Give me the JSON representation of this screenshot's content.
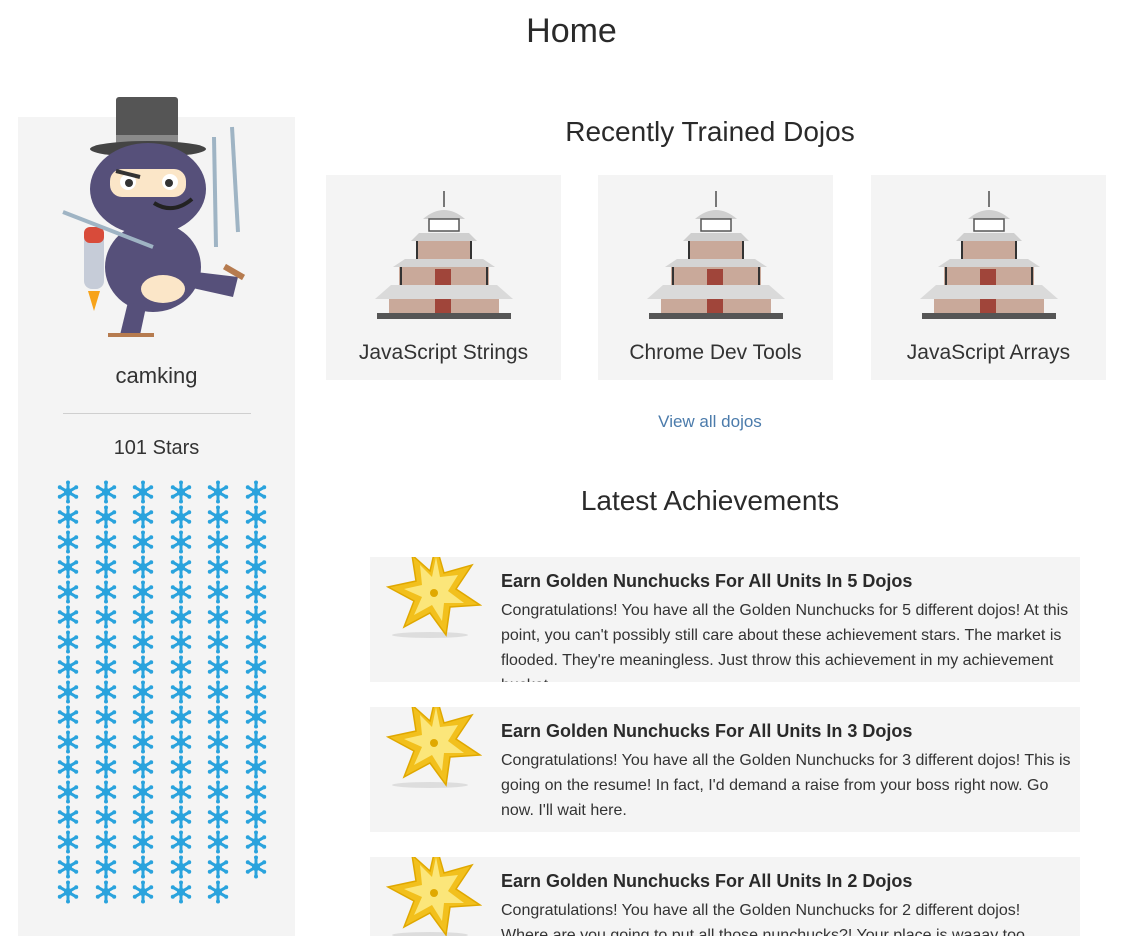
{
  "page": {
    "title": "Home"
  },
  "profile": {
    "username": "camking",
    "stars_label": "101 Stars",
    "star_count": 101,
    "star_color": "#2aa3dd"
  },
  "dojos": {
    "title": "Recently Trained Dojos",
    "items": [
      {
        "name": "JavaScript Strings",
        "icon": "temple-icon"
      },
      {
        "name": "Chrome Dev Tools",
        "icon": "temple-icon"
      },
      {
        "name": "JavaScript Arrays",
        "icon": "temple-icon"
      }
    ],
    "view_all": "View all dojos"
  },
  "achievements": {
    "title": "Latest Achievements",
    "items": [
      {
        "title": "Earn Golden Nunchucks For All Units In 5 Dojos",
        "description": "Congratulations! You have all the Golden Nunchucks for 5 different dojos! At this point, you can't possibly still care about these achievement stars. The market is flooded. They're meaningless. Just throw this achievement in my achievement bucket.",
        "icon": "gold-shuriken-icon"
      },
      {
        "title": "Earn Golden Nunchucks For All Units In 3 Dojos",
        "description": "Congratulations! You have all the Golden Nunchucks for 3 different dojos! This is going on the resume! In fact, I'd demand a raise from your boss right now. Go now. I'll wait here.",
        "icon": "gold-shuriken-icon"
      },
      {
        "title": "Earn Golden Nunchucks For All Units In 2 Dojos",
        "description": "Congratulations! You have all the Golden Nunchucks for 2 different dojos! Where are you going to put all those nunchucks?! Your place is waaay too small.",
        "icon": "gold-shuriken-icon"
      }
    ]
  },
  "colors": {
    "panel": "#f4f4f4",
    "link": "#4b7bab",
    "gold": "#f5c518"
  }
}
